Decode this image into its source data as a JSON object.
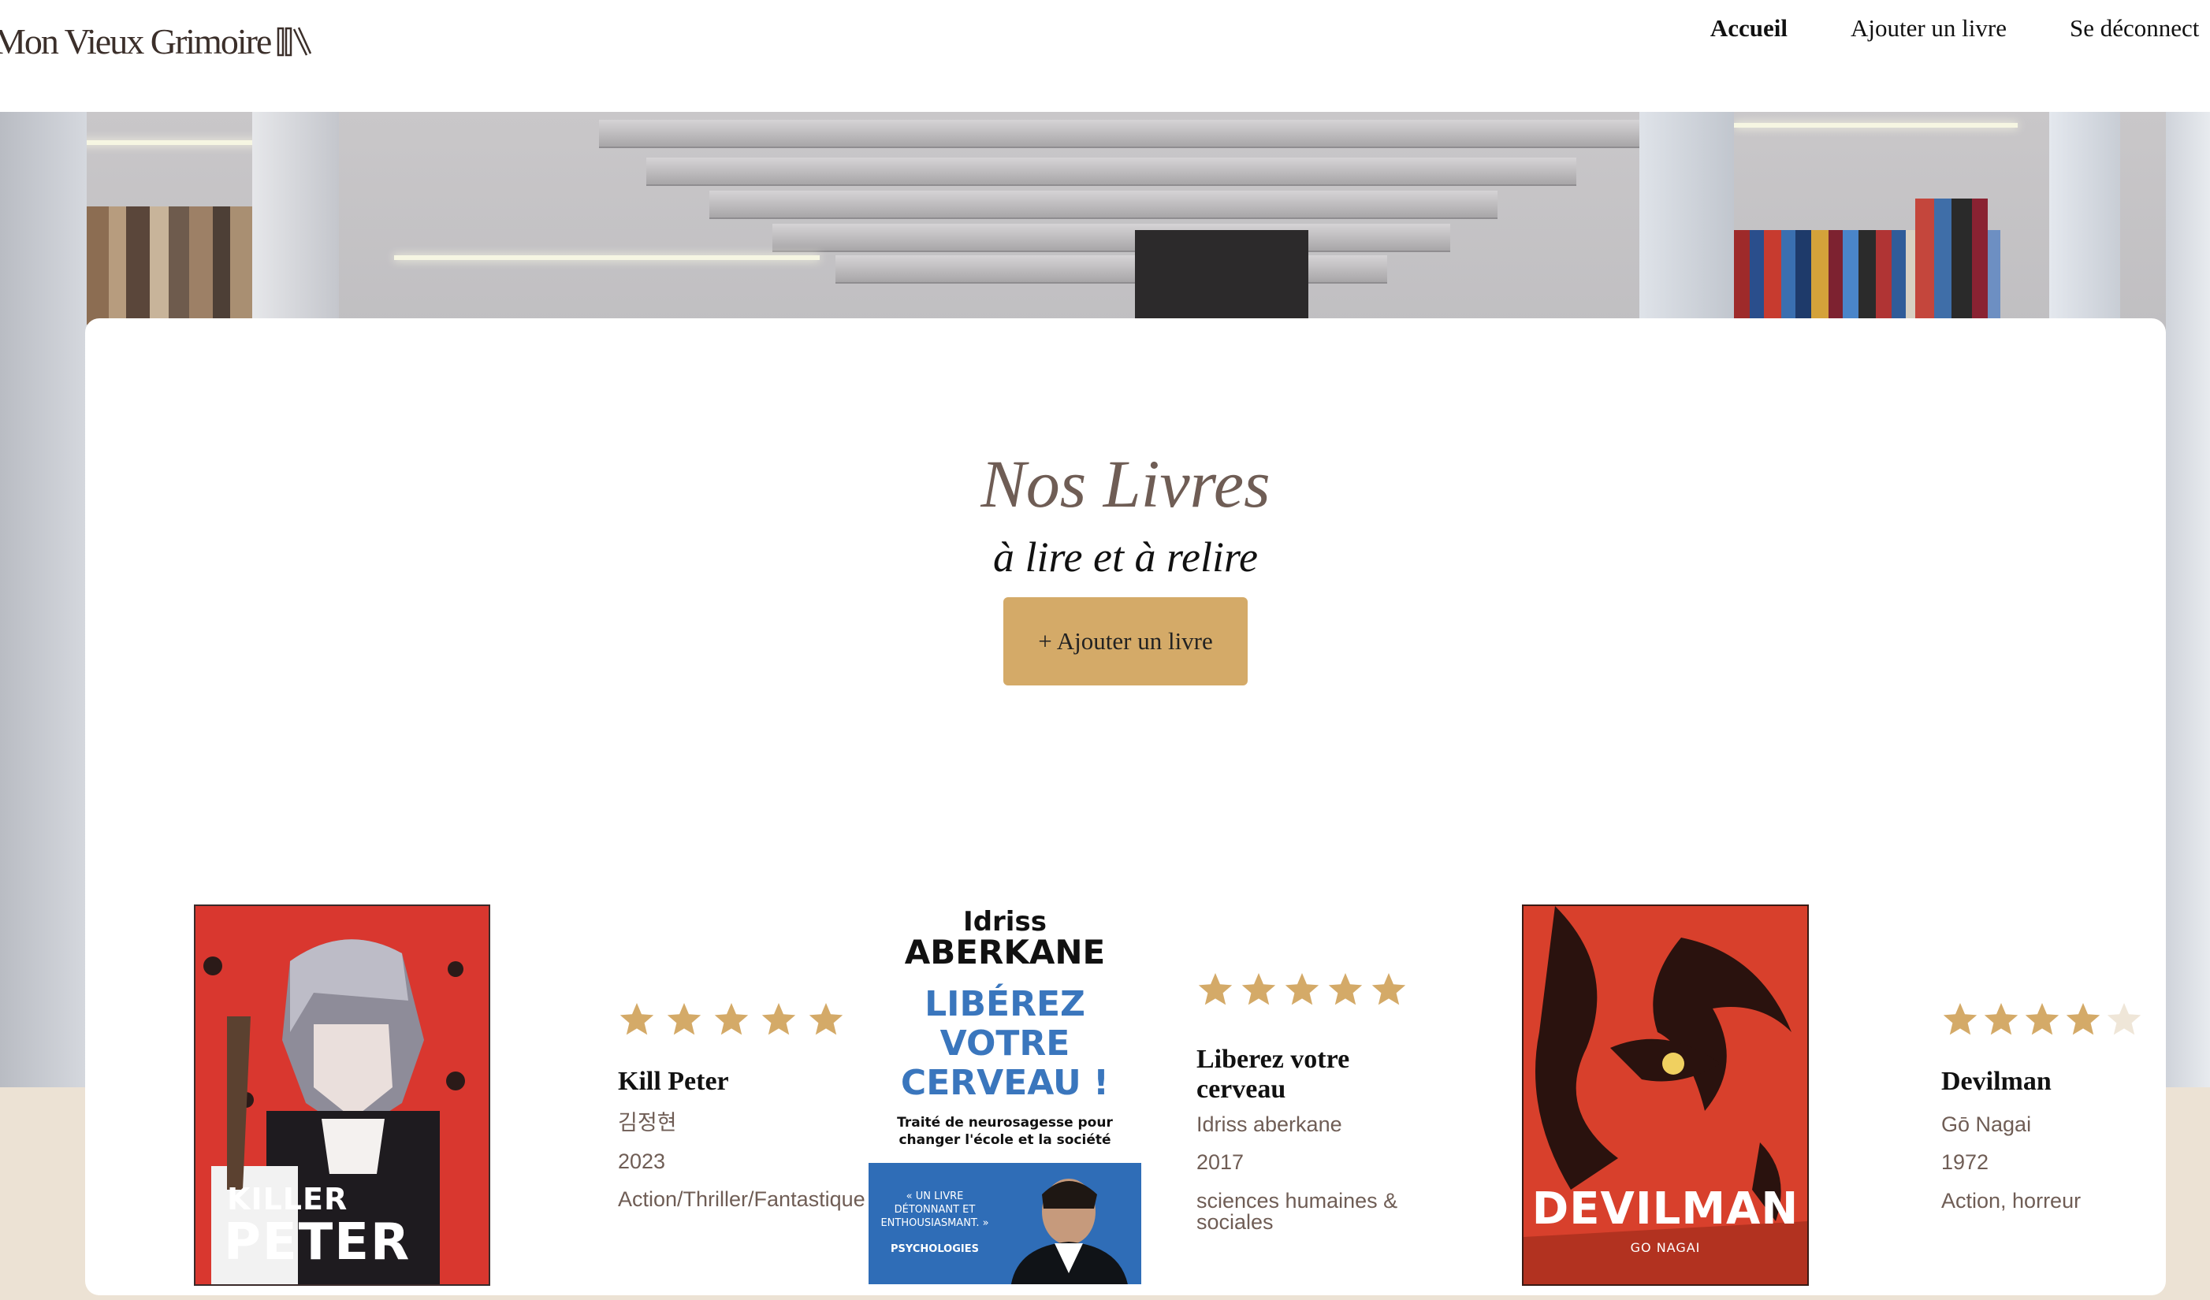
{
  "header": {
    "logo_text": "Mon Vieux Grimoire",
    "nav": [
      {
        "label": "Accueil",
        "active": true
      },
      {
        "label": "Ajouter un livre",
        "active": false
      },
      {
        "label": "Se déconnect",
        "active": false
      }
    ]
  },
  "main": {
    "title": "Nos Livres",
    "subtitle": "à lire et à relire",
    "add_button": "+ Ajouter un livre"
  },
  "books": [
    {
      "title": "Kill Peter",
      "author": "김정현",
      "year": "2023",
      "genre": "Action/Thriller/Fantastique",
      "rating": 5,
      "cover": {
        "top_text": "",
        "line1": "KILLER",
        "line2": "PETER"
      }
    },
    {
      "title": "Liberez votre cerveau",
      "author": "Idriss aberkane",
      "year": "2017",
      "genre": "sciences humaines & sociales",
      "rating": 5,
      "cover": {
        "author_first": "Idriss",
        "author_last": "ABERKANE",
        "title_lines": [
          "LIBÉREZ",
          "VOTRE",
          "CERVEAU !"
        ],
        "tagline": "Traité de neurosagesse pour changer l'école et la société",
        "quote": "« UN LIVRE DÉTONNANT ET ENTHOUSIASMANT. »",
        "quote_source": "PSYCHOLOGIES"
      }
    },
    {
      "title": "Devilman",
      "author": "Gō Nagai",
      "year": "1972",
      "genre": "Action, horreur",
      "rating": 4,
      "cover": {
        "title": "DEVILMAN",
        "author": "GO NAGAI"
      }
    }
  ],
  "colors": {
    "accent": "#d4aa68",
    "star_filled": "#d4aa68",
    "star_empty": "#efe6d8",
    "title_brown": "#6f5d55",
    "page_beige": "#ece2d4"
  },
  "icons": {
    "logo": "books-icon",
    "rating": "star-icon"
  }
}
